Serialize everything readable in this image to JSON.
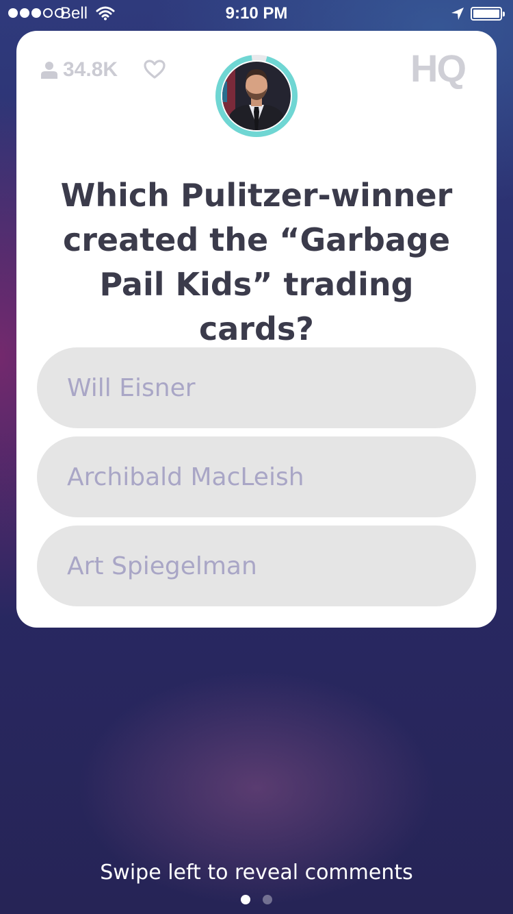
{
  "status_bar": {
    "carrier": "Bell",
    "time": "9:10 PM",
    "signal_bars_filled": 3,
    "signal_bars_total": 5,
    "battery_level": 1.0,
    "icons": [
      "wifi-icon",
      "location-arrow-icon",
      "battery-icon"
    ]
  },
  "card": {
    "viewer_count": "34.8K",
    "logo_text": "HQ",
    "question": "Which Pulitzer-winner created the “Garbage Pail Kids” trading cards?",
    "answers": [
      {
        "label": "Will Eisner"
      },
      {
        "label": "Archibald MacLeish"
      },
      {
        "label": "Art Spiegelman"
      }
    ],
    "icons": [
      "person-icon",
      "heart-icon",
      "host-avatar"
    ]
  },
  "footer": {
    "hint": "Swipe left to reveal comments",
    "page_count": 2,
    "active_page": 1
  },
  "colors": {
    "timer_ring": "#6fd6d3",
    "answer_bg": "#e5e5e5",
    "answer_text": "#a9a6c6",
    "question_text": "#3b3b4b",
    "background": "#2a2a68"
  }
}
